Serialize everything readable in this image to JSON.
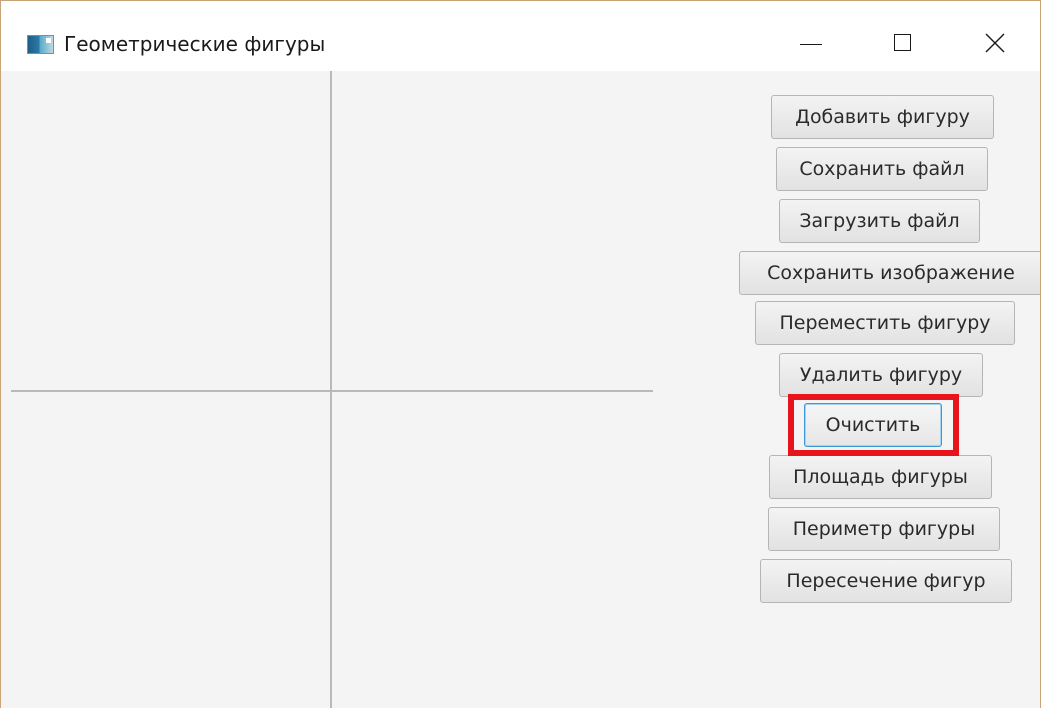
{
  "window": {
    "title": "Геометрические фигуры",
    "icon": "app-window-icon",
    "controls": {
      "minimize": "minimize-icon",
      "maximize": "maximize-icon",
      "close": "close-icon"
    }
  },
  "buttons": [
    {
      "label": "Добавить фигуру"
    },
    {
      "label": "Сохранить файл"
    },
    {
      "label": "Загрузить файл"
    },
    {
      "label": "Сохранить изображение"
    },
    {
      "label": "Переместить фигуру"
    },
    {
      "label": "Удалить фигуру"
    },
    {
      "label": "Очистить",
      "focused": true,
      "highlighted": true
    },
    {
      "label": "Площадь фигуры"
    },
    {
      "label": "Периметр фигуры"
    },
    {
      "label": "Пересечение фигур"
    }
  ],
  "colors": {
    "highlight": "#e8141c",
    "focus_border": "#3b99d6",
    "axis": "#b9b9b9",
    "window_border": "#c9a479"
  }
}
